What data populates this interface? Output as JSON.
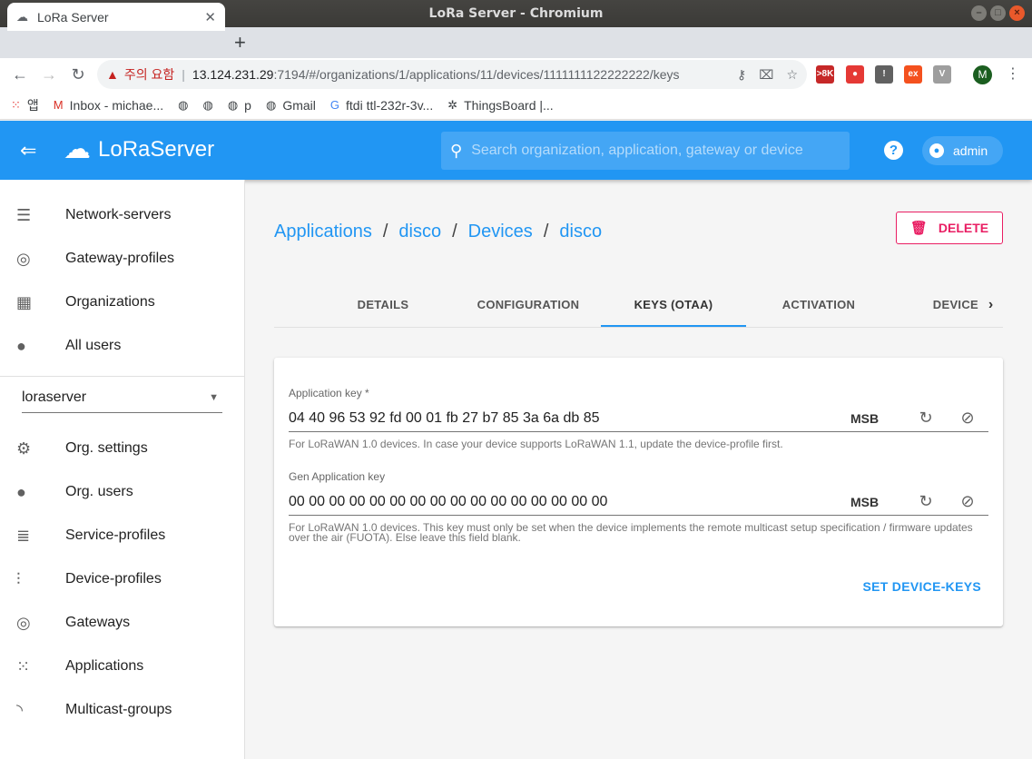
{
  "window": {
    "title": "LoRa Server - Chromium"
  },
  "browser": {
    "tab_title": "LoRa Server",
    "security_warning": "주의 요함",
    "url_host": "13.124.231.29",
    "url_path": ":7194/#/organizations/1/applications/11/devices/1111111122222222/keys",
    "bookmarks": [
      {
        "label": "앱",
        "icon": "apps-grid-icon"
      },
      {
        "label": "Inbox - michae...",
        "icon": "gmail-icon"
      },
      {
        "label": "",
        "icon": "globe-icon"
      },
      {
        "label": "",
        "icon": "globe-icon"
      },
      {
        "label": "p",
        "icon": "globe-icon"
      },
      {
        "label": "Gmail",
        "icon": "globe-icon"
      },
      {
        "label": "ftdi ttl-232r-3v...",
        "icon": "google-icon"
      },
      {
        "label": "ThingsBoard |...",
        "icon": "thingsboard-icon"
      }
    ],
    "extensions": [
      {
        "label": ">8K",
        "color": "#c62828"
      },
      {
        "label": "●",
        "color": "#e53935"
      },
      {
        "label": "!",
        "color": "#616161"
      },
      {
        "label": "ex",
        "color": "#f4511e"
      },
      {
        "label": "V",
        "color": "#9e9e9e"
      }
    ],
    "profile_initial": "M"
  },
  "appbar": {
    "logo_text": "LoRaServer",
    "search_placeholder": "Search organization, application, gateway or device",
    "user": "admin"
  },
  "sidebar": {
    "global_items": [
      {
        "label": "Network-servers",
        "icon": "server-icon"
      },
      {
        "label": "Gateway-profiles",
        "icon": "gateway-icon"
      },
      {
        "label": "Organizations",
        "icon": "building-icon"
      },
      {
        "label": "All users",
        "icon": "person-icon"
      }
    ],
    "org_selected": "loraserver",
    "org_items": [
      {
        "label": "Org. settings",
        "icon": "gear-icon"
      },
      {
        "label": "Org. users",
        "icon": "person-icon"
      },
      {
        "label": "Service-profiles",
        "icon": "profile-list-icon"
      },
      {
        "label": "Device-profiles",
        "icon": "sliders-icon"
      },
      {
        "label": "Gateways",
        "icon": "gateway-icon"
      },
      {
        "label": "Applications",
        "icon": "apps-icon"
      },
      {
        "label": "Multicast-groups",
        "icon": "rss-icon"
      }
    ]
  },
  "breadcrumb": {
    "items": [
      "Applications",
      "disco",
      "Devices",
      "disco"
    ],
    "separator": "/"
  },
  "delete_label": "DELETE",
  "tabs": [
    "DETAILS",
    "CONFIGURATION",
    "KEYS (OTAA)",
    "ACTIVATION",
    "DEVICE"
  ],
  "active_tab": "KEYS (OTAA)",
  "form": {
    "app_key": {
      "label": "Application key *",
      "value": "04 40 96 53 92 fd 00 01 fb 27 b7 85 3a 6a db 85",
      "byte_order": "MSB",
      "help": "For LoRaWAN 1.0 devices. In case your device supports LoRaWAN 1.1, update the device-profile first."
    },
    "gen_app_key": {
      "label": "Gen Application key",
      "value": "00 00 00 00 00 00 00 00 00 00 00 00 00 00 00 00",
      "byte_order": "MSB",
      "help": "For LoRaWAN 1.0 devices. This key must only be set when the device implements the remote multicast setup specification / firmware updates over the air (FUOTA). Else leave this field blank."
    },
    "submit_label": "SET DEVICE-KEYS"
  },
  "colors": {
    "primary": "#2196f3",
    "danger": "#e91e63"
  }
}
